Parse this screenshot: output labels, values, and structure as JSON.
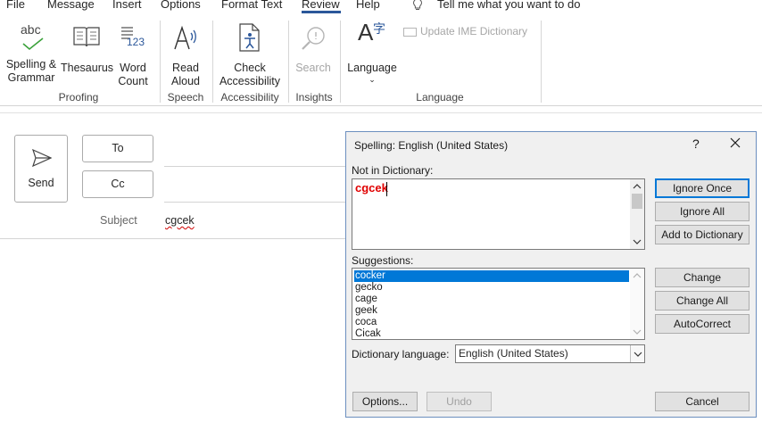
{
  "tabs": {
    "file": "File",
    "message": "Message",
    "insert": "Insert",
    "options": "Options",
    "format_text": "Format Text",
    "review": "Review",
    "help": "Help",
    "tell_me": "Tell me what you want to do"
  },
  "ribbon": {
    "spelling_line1": "Spelling &",
    "spelling_line2": "Grammar",
    "spelling_icon_text": "abc",
    "thesaurus": "Thesaurus",
    "word_count_line1": "Word",
    "word_count_line2": "Count",
    "word_count_icon_text": "123",
    "read_aloud_line1": "Read",
    "read_aloud_line2": "Aloud",
    "check_access_line1": "Check",
    "check_access_line2": "Accessibility",
    "search": "Search",
    "language": "Language",
    "language_icon_text": "A",
    "language_icon_text2": "字",
    "update_ime": "Update IME Dictionary",
    "groups": {
      "proofing": "Proofing",
      "speech": "Speech",
      "accessibility": "Accessibility",
      "insights": "Insights",
      "language": "Language"
    }
  },
  "compose": {
    "send": "Send",
    "to": "To",
    "cc": "Cc",
    "subject_label": "Subject",
    "subject_value": "cgcek"
  },
  "dialog": {
    "title": "Spelling: English (United States)",
    "help": "?",
    "not_in_dict_label": "Not in Dictionary:",
    "not_in_dict_word": "cgcek",
    "suggestions_label": "Suggestions:",
    "suggestions": [
      "cocker",
      "gecko",
      "cage",
      "geek",
      "coca",
      "Cicak"
    ],
    "dict_lang_label": "Dictionary language:",
    "dict_lang_value": "English (United States)",
    "buttons": {
      "ignore_once": "Ignore Once",
      "ignore_all": "Ignore All",
      "add_to_dictionary": "Add to Dictionary",
      "change": "Change",
      "change_all": "Change All",
      "autocorrect": "AutoCorrect",
      "options": "Options...",
      "undo": "Undo",
      "cancel": "Cancel"
    }
  },
  "colors": {
    "accent": "#2b579a",
    "selection": "#0078d7",
    "misspelled": "#e00000"
  }
}
